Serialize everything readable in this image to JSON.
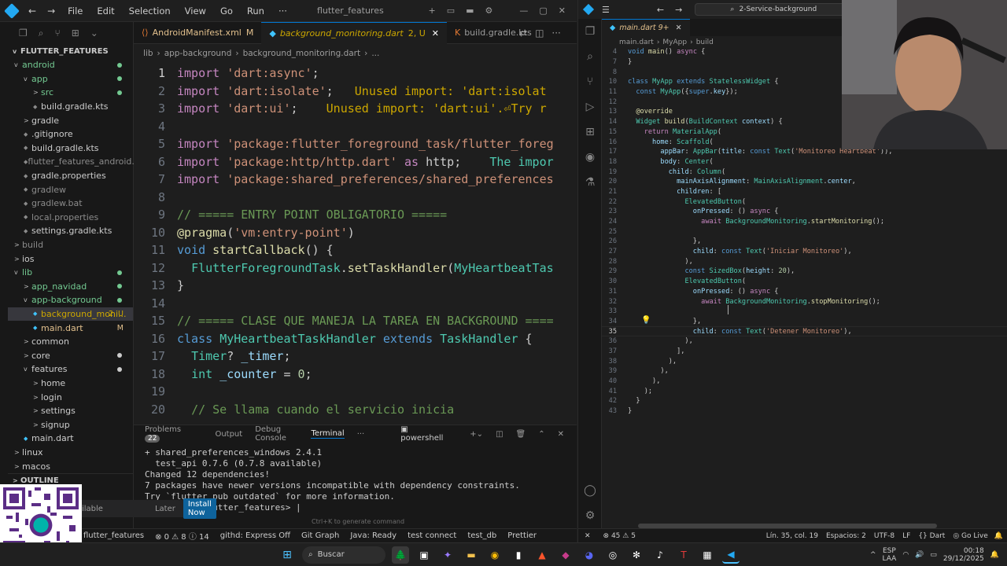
{
  "left_window": {
    "menu": [
      "File",
      "Edit",
      "Selection",
      "View",
      "Go",
      "Run",
      "···"
    ],
    "title": "flutter_features",
    "tabs": [
      {
        "label": "AndroidManifest.xml",
        "status": "M"
      },
      {
        "label": "background_monitoring.dart",
        "status": "2, U"
      },
      {
        "label": "build.gradle.kts",
        "status": ""
      }
    ],
    "breadcrumb": [
      "lib",
      "app-background",
      "background_monitoring.dart",
      "..."
    ],
    "explorer_title": "FLUTTER_FEATURES",
    "tree": [
      {
        "indent": 0,
        "label": "android",
        "chev": "v",
        "color": "#73c991",
        "dot": true
      },
      {
        "indent": 1,
        "label": "app",
        "chev": "v",
        "color": "#73c991",
        "dot": true
      },
      {
        "indent": 2,
        "label": "src",
        "chev": ">",
        "color": "#73c991",
        "dot": true
      },
      {
        "indent": 2,
        "label": "build.gradle.kts",
        "chev": "",
        "color": "#cccccc"
      },
      {
        "indent": 1,
        "label": "gradle",
        "chev": ">",
        "color": "#cccccc"
      },
      {
        "indent": 1,
        "label": ".gitignore",
        "chev": "",
        "color": "#cccccc"
      },
      {
        "indent": 1,
        "label": "build.gradle.kts",
        "chev": "",
        "color": "#cccccc"
      },
      {
        "indent": 1,
        "label": "flutter_features_android.iml",
        "chev": "",
        "color": "#8b8b8b"
      },
      {
        "indent": 1,
        "label": "gradle.properties",
        "chev": "",
        "color": "#cccccc"
      },
      {
        "indent": 1,
        "label": "gradlew",
        "chev": "",
        "color": "#8b8b8b"
      },
      {
        "indent": 1,
        "label": "gradlew.bat",
        "chev": "",
        "color": "#8b8b8b"
      },
      {
        "indent": 1,
        "label": "local.properties",
        "chev": "",
        "color": "#8b8b8b"
      },
      {
        "indent": 1,
        "label": "settings.gradle.kts",
        "chev": "",
        "color": "#cccccc"
      },
      {
        "indent": 0,
        "label": "build",
        "chev": ">",
        "color": "#8b8b8b"
      },
      {
        "indent": 0,
        "label": "ios",
        "chev": ">",
        "color": "#cccccc"
      },
      {
        "indent": 0,
        "label": "lib",
        "chev": "v",
        "color": "#73c991",
        "dot": true
      },
      {
        "indent": 1,
        "label": "app_navidad",
        "chev": ">",
        "color": "#73c991",
        "dot": true
      },
      {
        "indent": 1,
        "label": "app-background",
        "chev": "v",
        "color": "#73c991",
        "dot": true
      },
      {
        "indent": 2,
        "label": "background_moni...",
        "chev": "",
        "color": "#cca700",
        "badge": "2, U",
        "active": true
      },
      {
        "indent": 2,
        "label": "main.dart",
        "chev": "",
        "color": "#e2c08d",
        "badge": "M"
      },
      {
        "indent": 1,
        "label": "common",
        "chev": ">",
        "color": "#cccccc"
      },
      {
        "indent": 1,
        "label": "core",
        "chev": ">",
        "color": "#cccccc",
        "dot": true
      },
      {
        "indent": 1,
        "label": "features",
        "chev": "v",
        "color": "#cccccc",
        "dot": true
      },
      {
        "indent": 2,
        "label": "home",
        "chev": ">",
        "color": "#cccccc"
      },
      {
        "indent": 2,
        "label": "login",
        "chev": ">",
        "color": "#cccccc"
      },
      {
        "indent": 2,
        "label": "settings",
        "chev": ">",
        "color": "#cccccc"
      },
      {
        "indent": 2,
        "label": "signup",
        "chev": ">",
        "color": "#cccccc"
      },
      {
        "indent": 1,
        "label": "main.dart",
        "chev": "",
        "color": "#cccccc"
      },
      {
        "indent": 0,
        "label": "linux",
        "chev": ">",
        "color": "#cccccc"
      },
      {
        "indent": 0,
        "label": "macos",
        "chev": ">",
        "color": "#cccccc"
      }
    ],
    "outline_label": "OUTLINE",
    "code_lines": [
      {
        "n": "1",
        "html": "<span class='kw'>import</span> <span class='str'>'dart:async'</span>;"
      },
      {
        "n": "2",
        "html": "<span class='kw'>import</span> <span class='str'>'dart:isolate'</span>;   <span class='warn'>Unused import: 'dart:isolat</span>"
      },
      {
        "n": "3",
        "html": "<span class='kw'>import</span> <span class='str'>'dart:ui'</span>;    <span class='warn'>Unused import: 'dart:ui'.⏎Try r</span>"
      },
      {
        "n": "4",
        "html": ""
      },
      {
        "n": "5",
        "html": "<span class='kw'>import</span> <span class='str'>'package:flutter_foreground_task/flutter_foreg</span>"
      },
      {
        "n": "6",
        "html": "<span class='kw'>import</span> <span class='str'>'package:http/http.dart'</span> <span class='kw'>as</span> http;    <span class='ty'>The impor</span>"
      },
      {
        "n": "7",
        "html": "<span class='kw'>import</span> <span class='str'>'package:shared_preferences/shared_preferences</span>"
      },
      {
        "n": "8",
        "html": ""
      },
      {
        "n": "9",
        "html": "<span class='cm'>// ===== ENTRY POINT OBLIGATORIO =====</span>"
      },
      {
        "n": "10",
        "html": "<span class='fn'>@pragma</span>(<span class='str'>'vm:entry-point'</span>)"
      },
      {
        "n": "11",
        "html": "<span class='kb'>void</span> <span class='fn'>startCallback</span>() {"
      },
      {
        "n": "12",
        "html": "  <span class='ty'>FlutterForegroundTask</span>.<span class='fn'>setTaskHandler</span>(<span class='ty'>MyHeartbeatTas</span>"
      },
      {
        "n": "13",
        "html": "}"
      },
      {
        "n": "14",
        "html": ""
      },
      {
        "n": "15",
        "html": "<span class='cm'>// ===== CLASE QUE MANEJA LA TAREA EN BACKGROUND ====</span>"
      },
      {
        "n": "16",
        "html": "<span class='kb'>class</span> <span class='ty'>MyHeartbeatTaskHandler</span> <span class='kb'>extends</span> <span class='ty'>TaskHandler</span> {"
      },
      {
        "n": "17",
        "html": "  <span class='ty'>Timer</span>? <span class='vr'>_timer</span>;"
      },
      {
        "n": "18",
        "html": "  <span class='ty'>int</span> <span class='vr'>_counter</span> = <span class='num'>0</span>;"
      },
      {
        "n": "19",
        "html": ""
      },
      {
        "n": "20",
        "html": "  <span class='cm'>// Se llama cuando el servicio inicia</span>"
      }
    ],
    "panel_tabs": {
      "problems": "Problems",
      "problems_count": "22",
      "output": "Output",
      "debug": "Debug Console",
      "terminal": "Terminal",
      "shell": "powershell"
    },
    "terminal_lines": [
      "+ shared_preferences_windows 2.4.1",
      "  test_api 0.7.6 (0.7.8 available)",
      "Changed 12 dependencies!",
      "7 packages have newer versions incompatible with dependency constraints.",
      "Try `flutter pub outdated` for more information.",
      "PS C:\\...r\\flutter_features> |"
    ],
    "generate_hint": "Ctrl+K to generate command",
    "notif": {
      "later": "Later",
      "install": "Install Now",
      "available": "ilable"
    },
    "status": [
      "flutter_features",
      "⊗ 0  ⚠ 8  ⓘ 14",
      "githd: Express Off",
      "Git Graph",
      "Java: Ready",
      "test connect",
      "test_db",
      "Prettier"
    ]
  },
  "right_window": {
    "search": "2-Service-background",
    "tab": "main.dart 9+",
    "breadcrumb": [
      "main.dart",
      "MyApp",
      "build"
    ],
    "code_lines": [
      {
        "n": "4",
        "html": "<span class='kb'>void</span> <span class='fn'>main</span>() <span class='kw'>async</span> {"
      },
      {
        "n": "7",
        "html": "}"
      },
      {
        "n": "8",
        "html": ""
      },
      {
        "n": "10",
        "html": "<span class='kb'>class</span> <span class='ty'>MyApp</span> <span class='kb'>extends</span> <span class='ty'>StatelessWidget</span> {"
      },
      {
        "n": "11",
        "html": "  <span class='kb'>const</span> <span class='ty'>MyApp</span>({<span class='kb'>super</span>.<span class='vr'>key</span>});"
      },
      {
        "n": "12",
        "html": ""
      },
      {
        "n": "13",
        "html": "  <span class='fn'>@override</span>"
      },
      {
        "n": "14",
        "html": "  <span class='ty'>Widget</span> <span class='fn'>build</span>(<span class='ty'>BuildContext</span> <span class='vr'>context</span>) {"
      },
      {
        "n": "15",
        "html": "    <span class='kw'>return</span> <span class='ty'>MaterialApp</span>("
      },
      {
        "n": "16",
        "html": "      <span class='vr'>home</span>: <span class='ty'>Scaffold</span>("
      },
      {
        "n": "17",
        "html": "        <span class='vr'>appBar</span>: <span class='ty'>AppBar</span>(<span class='vr'>title</span>: <span class='kb'>const</span> <span class='ty'>Text</span>(<span class='str'>'Monitoreo Heartbeat'</span>)),"
      },
      {
        "n": "18",
        "html": "        <span class='vr'>body</span>: <span class='ty'>Center</span>("
      },
      {
        "n": "19",
        "html": "          <span class='vr'>child</span>: <span class='ty'>Column</span>("
      },
      {
        "n": "20",
        "html": "            <span class='vr'>mainAxisAlignment</span>: <span class='ty'>MainAxisAlignment</span>.<span class='vr'>center</span>,"
      },
      {
        "n": "21",
        "html": "            <span class='vr'>children</span>: ["
      },
      {
        "n": "22",
        "html": "              <span class='ty'>ElevatedButton</span>("
      },
      {
        "n": "23",
        "html": "                <span class='vr'>onPressed</span>: () <span class='kw'>async</span> {"
      },
      {
        "n": "24",
        "html": "                  <span class='kw'>await</span> <span class='ty'>BackgroundMonitoring</span>.<span class='fn'>startMonitoring</span>();"
      },
      {
        "n": "25",
        "html": ""
      },
      {
        "n": "26",
        "html": "                },"
      },
      {
        "n": "27",
        "html": "                <span class='vr'>child</span>: <span class='kb'>const</span> <span class='ty'>Text</span>(<span class='str'>'Iniciar Monitoreo'</span>),"
      },
      {
        "n": "28",
        "html": "              ),"
      },
      {
        "n": "29",
        "html": "              <span class='kb'>const</span> <span class='ty'>SizedBox</span>(<span class='vr'>height</span>: <span class='num'>20</span>),"
      },
      {
        "n": "30",
        "html": "              <span class='ty'>ElevatedButton</span>("
      },
      {
        "n": "31",
        "html": "                <span class='vr'>onPressed</span>: () <span class='kw'>async</span> {"
      },
      {
        "n": "32",
        "html": "                  <span class='kw'>await</span> <span class='ty'>BackgroundMonitoring</span>.<span class='fn'>stopMonitoring</span>();"
      },
      {
        "n": "33",
        "html": ""
      },
      {
        "n": "34",
        "html": "                },"
      },
      {
        "n": "35",
        "html": "                <span class='vr'>child</span>: <span class='kb'>const</span> <span class='ty'>Text</span>(<span class='str'>'Detener Monitoreo'</span>),"
      },
      {
        "n": "36",
        "html": "              ),"
      },
      {
        "n": "37",
        "html": "            ],"
      },
      {
        "n": "38",
        "html": "          ),"
      },
      {
        "n": "39",
        "html": "        ),"
      },
      {
        "n": "40",
        "html": "      ),"
      },
      {
        "n": "41",
        "html": "    );"
      },
      {
        "n": "42",
        "html": "  }"
      },
      {
        "n": "43",
        "html": "}"
      },
      {
        "n": "44",
        "html": ""
      }
    ],
    "status": {
      "errors": "⊗ 45 ⚠ 5",
      "pos": "Lín. 35, col. 19",
      "spaces": "Espacios: 2",
      "enc": "UTF-8",
      "eol": "LF",
      "lang": "Dart",
      "golive": "Go Live"
    }
  },
  "taskbar": {
    "search": "Buscar",
    "lang": "ESP",
    "region": "LAA",
    "time": "00:18",
    "date": "29/12/2025"
  },
  "colors": {
    "accent": "#0078d4",
    "modified": "#e2c08d",
    "untracked": "#73c991",
    "warning": "#cca700"
  }
}
